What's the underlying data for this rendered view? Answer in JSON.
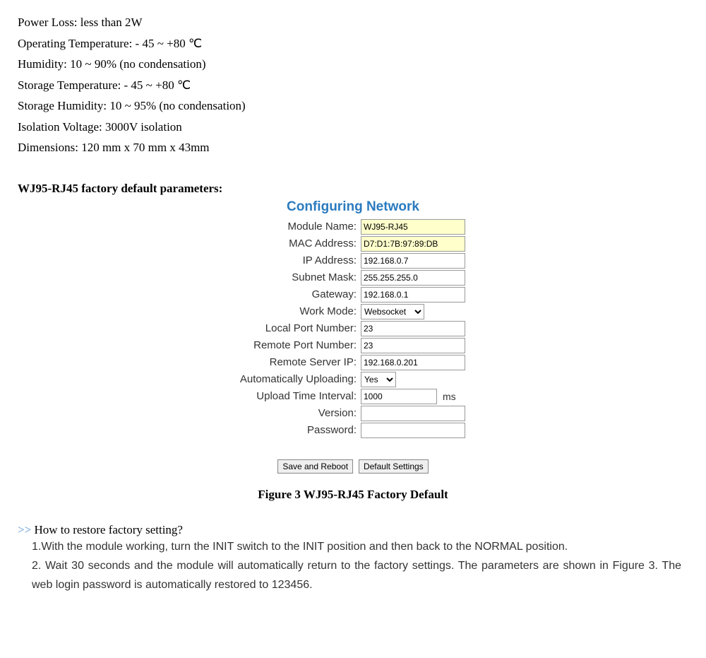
{
  "specs": {
    "power_loss": "Power Loss: less than 2W",
    "operating_temp": "Operating Temperature: - 45 ~ +80  ℃",
    "humidity": "Humidity: 10 ~ 90% (no condensation)",
    "storage_temp": "Storage Temperature: - 45 ~ +80  ℃",
    "storage_humidity": "Storage Humidity: 10 ~ 95% (no condensation)",
    "isolation": "Isolation Voltage: 3000V isolation",
    "dimensions": "Dimensions: 120 mm x 70 mm x 43mm"
  },
  "section_heading": "WJ95-RJ45 factory default parameters:",
  "config": {
    "title": "Configuring Network",
    "labels": {
      "module_name": "Module Name:",
      "mac": "MAC Address:",
      "ip": "IP Address:",
      "subnet": "Subnet Mask:",
      "gateway": "Gateway:",
      "work_mode": "Work Mode:",
      "local_port": "Local Port Number:",
      "remote_port": "Remote Port Number:",
      "remote_ip": "Remote Server IP:",
      "auto_upload": "Automatically Uploading:",
      "upload_interval": "Upload Time Interval:",
      "version": "Version:",
      "password": "Password:"
    },
    "values": {
      "module_name": "WJ95-RJ45",
      "mac": "D7:D1:7B:97:89:DB",
      "ip": "192.168.0.7",
      "subnet": "255.255.255.0",
      "gateway": "192.168.0.1",
      "work_mode": "Websocket",
      "local_port": "23",
      "remote_port": "23",
      "remote_ip": "192.168.0.201",
      "auto_upload": "Yes",
      "upload_interval": "1000",
      "version": "",
      "password": ""
    },
    "unit_ms": "ms",
    "buttons": {
      "save": "Save and Reboot",
      "default": "Default Settings"
    }
  },
  "figure_caption": "Figure 3 WJ95-RJ45 Factory Default",
  "howto": {
    "chevron": ">> ",
    "heading": "How to restore factory setting?",
    "step1": "1.With the module working, turn the INIT switch to the INIT position and then back to the NORMAL position.",
    "step2": "2. Wait 30 seconds and the module will automatically return to the factory settings. The parameters are shown in Figure 3. The web login password is automatically restored to 123456."
  }
}
